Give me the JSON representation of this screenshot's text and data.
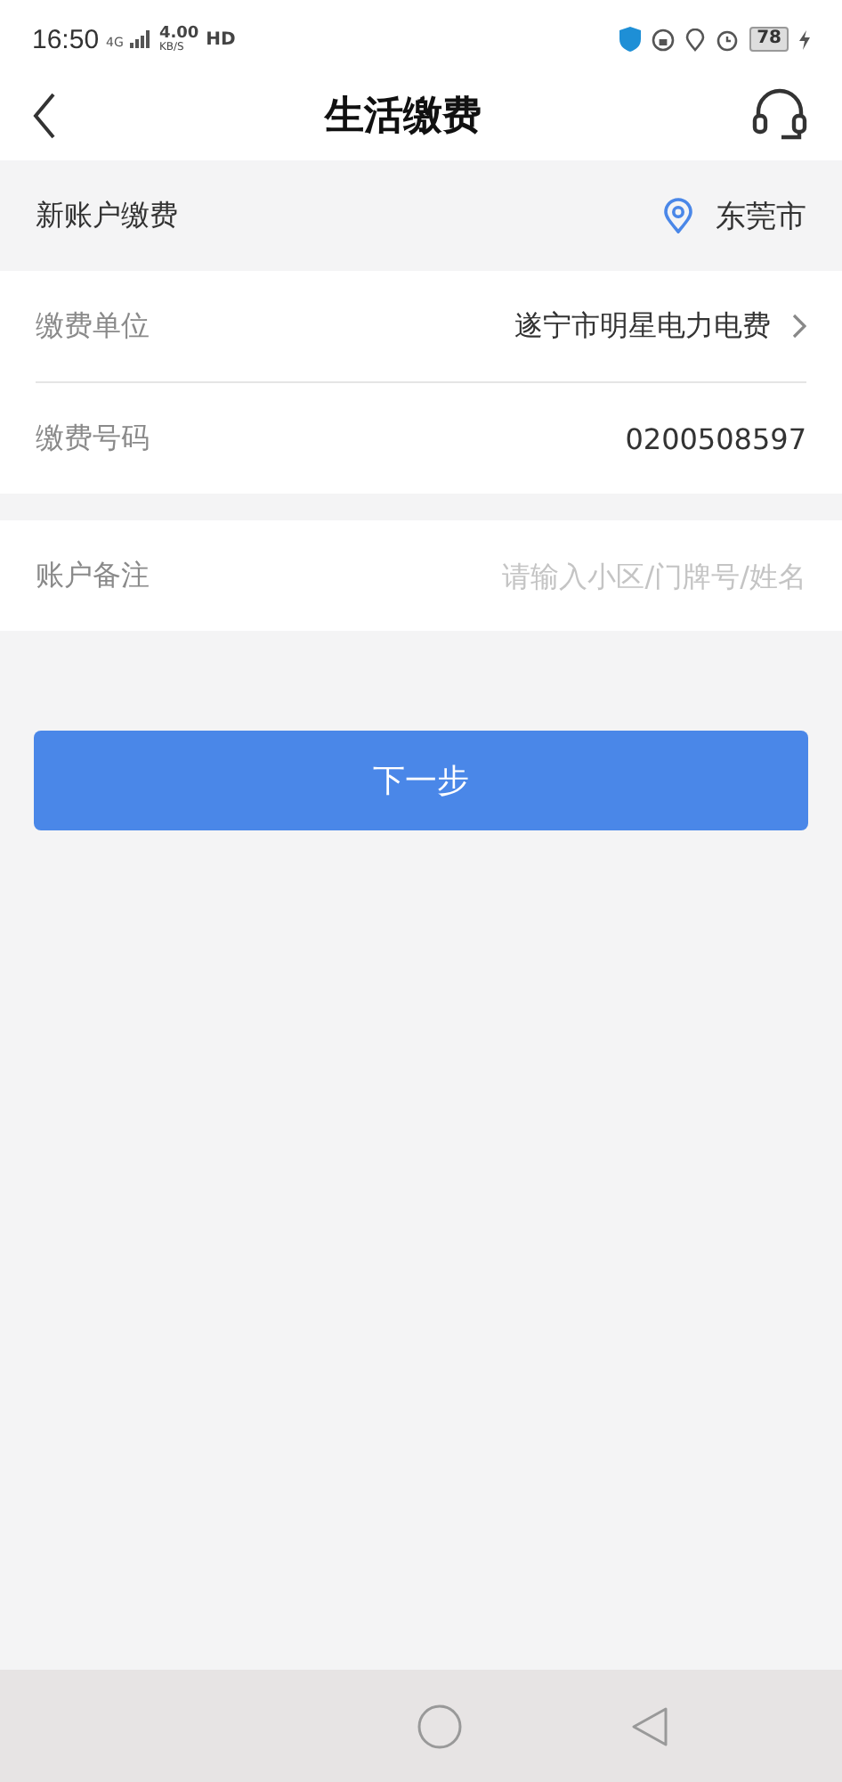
{
  "status_bar": {
    "time": "16:50",
    "network": "4G",
    "speed": "4.00",
    "speed_unit": "KB/S",
    "hd": "HD",
    "battery": "78"
  },
  "header": {
    "title": "生活缴费"
  },
  "section": {
    "title": "新账户缴费",
    "city": "东莞市"
  },
  "fields": [
    {
      "kind": "select",
      "label": "缴费单位",
      "value": "遂宁市明星电力电费"
    },
    {
      "kind": "text",
      "label": "缴费号码",
      "value": "0200508597"
    }
  ],
  "remark": {
    "label": "账户备注",
    "placeholder": "请输入小区/门牌号/姓名"
  },
  "next_button": "下一步"
}
